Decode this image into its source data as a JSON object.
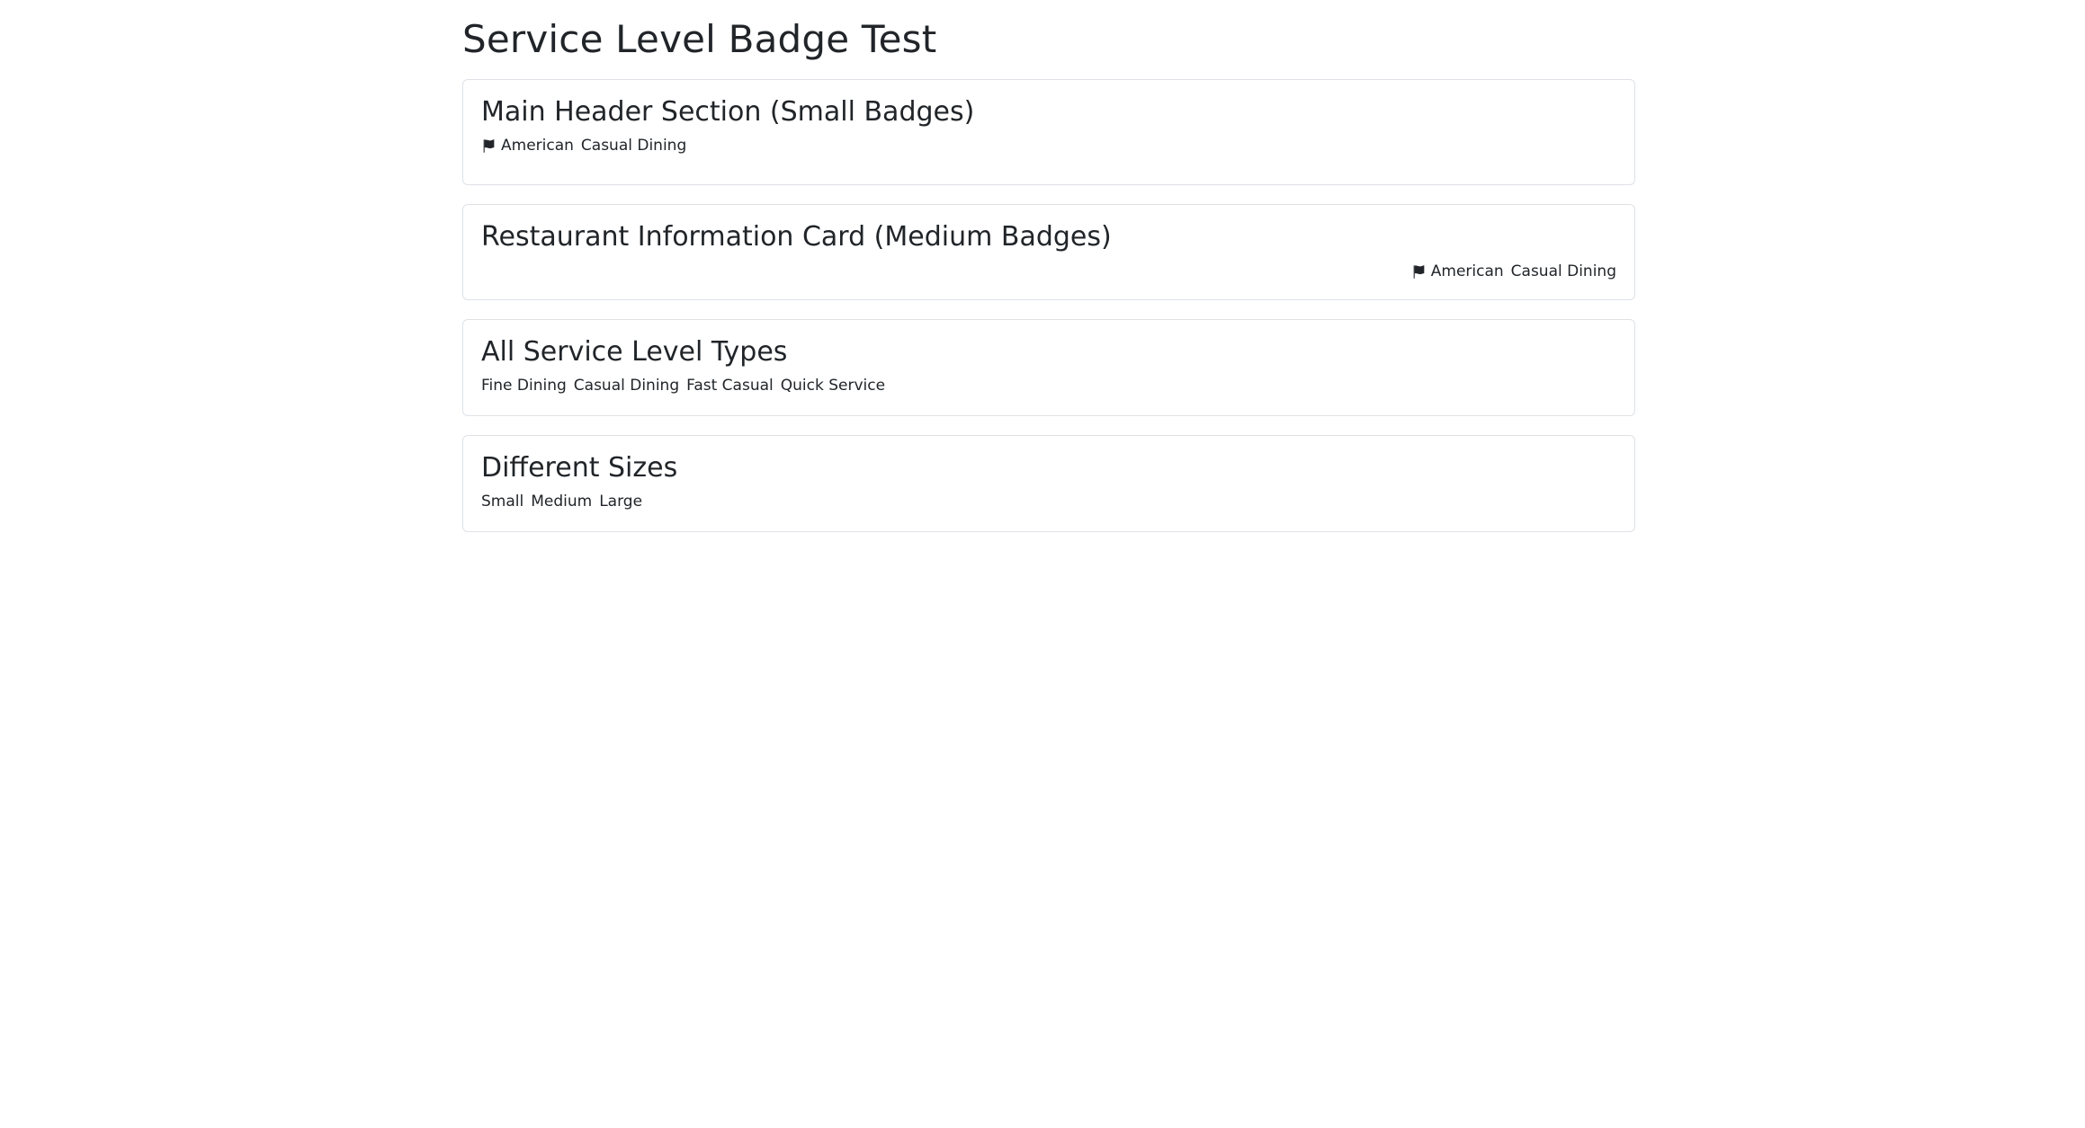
{
  "page": {
    "title": "Service Level Badge Test"
  },
  "sections": [
    {
      "title": "Main Header Section (Small Badges)",
      "badges": [
        {
          "label": "American",
          "icon": "flag-icon"
        },
        {
          "label": "Casual Dining"
        }
      ]
    },
    {
      "title": "Restaurant Information Card (Medium Badges)",
      "badges": [
        {
          "label": "American",
          "icon": "flag-icon"
        },
        {
          "label": "Casual Dining"
        }
      ]
    },
    {
      "title": "All Service Level Types",
      "badges": [
        {
          "label": "Fine Dining"
        },
        {
          "label": "Casual Dining"
        },
        {
          "label": "Fast Casual"
        },
        {
          "label": "Quick Service"
        }
      ]
    },
    {
      "title": "Different Sizes",
      "badges": [
        {
          "label": "Small"
        },
        {
          "label": "Medium"
        },
        {
          "label": "Large"
        }
      ]
    }
  ],
  "colors": {
    "text": "#212529",
    "border": "#dee2e6",
    "background": "#ffffff"
  }
}
